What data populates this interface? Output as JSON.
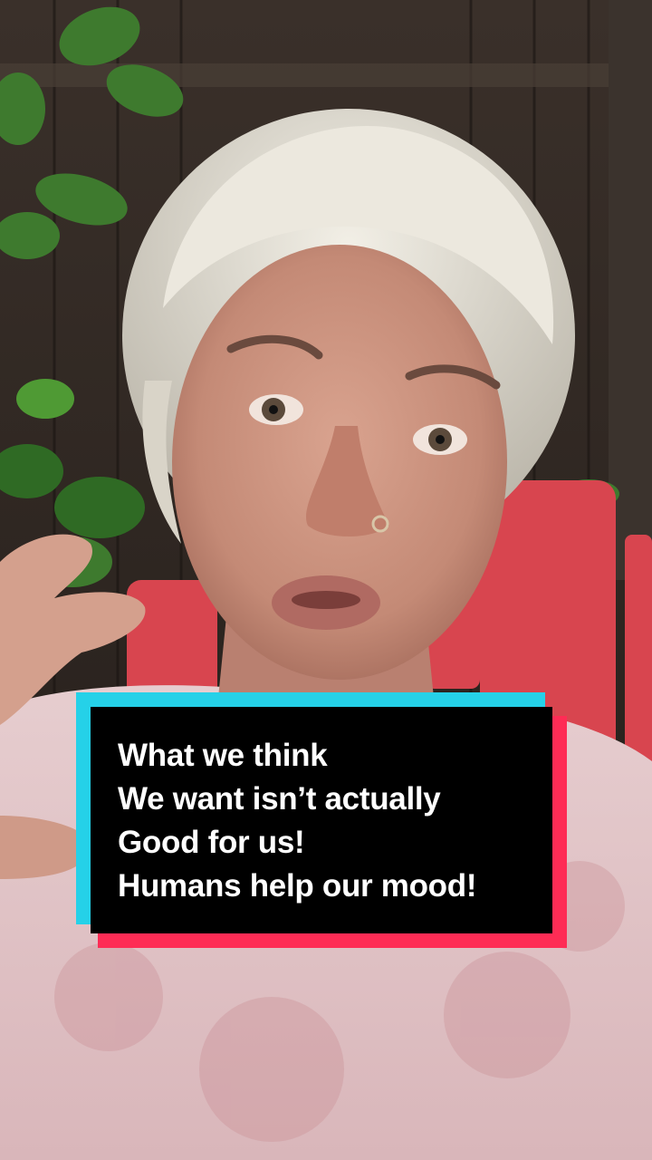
{
  "video": {
    "caption_lines": [
      "What we think",
      "We want isn’t actually",
      "Good for us!",
      "Humans help our mood!"
    ],
    "colors": {
      "caption_background": "#000000",
      "caption_text": "#ffffff",
      "accent_cyan": "#25d1e8",
      "accent_red": "#fe2c55"
    }
  }
}
